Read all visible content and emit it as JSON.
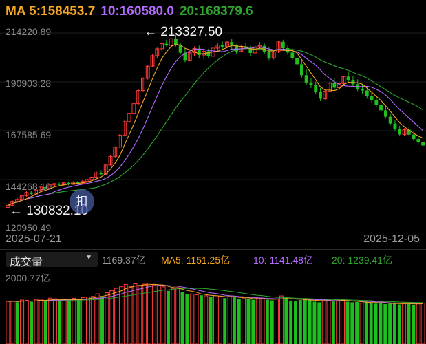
{
  "header": {
    "ma5": "MA 5:158453.7",
    "ma10": "10:160580.0",
    "ma20": "20:168379.6"
  },
  "colors": {
    "up": "#ff3b3b",
    "down": "#1fbf1f",
    "ma5": "#f5a623",
    "ma10": "#b36bff",
    "ma20": "#2fa52f",
    "bg": "#000000"
  },
  "y_ticks": [
    "214220.89",
    "190903.28",
    "167585.69",
    "144268.10",
    "120950.49"
  ],
  "dates": {
    "start": "2025-07-21",
    "end": "2025-12-05"
  },
  "annotations": {
    "high": "213327.50",
    "low": "130832.10"
  },
  "badge": {
    "text": "扣"
  },
  "volume_panel": {
    "selector_label": "成交量",
    "caret_icon": "caret-down-icon",
    "current": "1169.37亿",
    "ma5": "MA5: 1151.25亿",
    "ma10": "10: 1141.48亿",
    "ma20": "20: 1239.41亿",
    "max_label": "2000.77亿"
  },
  "chart_data": {
    "type": "candlestick",
    "price_range": [
      120950.49,
      214220.89
    ],
    "volume_max": 2000.77,
    "grid": true,
    "candles": [
      [
        131000,
        132200,
        130832.1,
        132000
      ],
      [
        132000,
        134300,
        131400,
        133900
      ],
      [
        133900,
        135600,
        133200,
        134800
      ],
      [
        134800,
        137000,
        134100,
        136600
      ],
      [
        136600,
        138800,
        136000,
        138100
      ],
      [
        138100,
        139000,
        136900,
        137400
      ],
      [
        137400,
        139800,
        137000,
        139300
      ],
      [
        139300,
        141200,
        138900,
        140700
      ],
      [
        140700,
        141300,
        139500,
        140100
      ],
      [
        140100,
        142100,
        139800,
        141700
      ],
      [
        141700,
        142600,
        140800,
        142300
      ],
      [
        142300,
        142800,
        141200,
        141800
      ],
      [
        141800,
        143100,
        141400,
        142700
      ],
      [
        142700,
        143300,
        141500,
        142000
      ],
      [
        142000,
        143500,
        141700,
        143000
      ],
      [
        143000,
        143600,
        141900,
        142400
      ],
      [
        142400,
        144000,
        142000,
        143500
      ],
      [
        143500,
        144700,
        143200,
        144300
      ],
      [
        144300,
        145800,
        143900,
        145400
      ],
      [
        145400,
        148000,
        145000,
        147500
      ],
      [
        147500,
        148700,
        146200,
        146800
      ],
      [
        146800,
        151600,
        146300,
        151200
      ],
      [
        151200,
        155800,
        150900,
        155300
      ],
      [
        155300,
        160200,
        154800,
        159800
      ],
      [
        159800,
        166000,
        159300,
        165500
      ],
      [
        165500,
        172400,
        165000,
        171900
      ],
      [
        171900,
        176300,
        170800,
        175900
      ],
      [
        175900,
        181000,
        175400,
        180500
      ],
      [
        180500,
        187300,
        180000,
        186800
      ],
      [
        186800,
        193100,
        186000,
        192600
      ],
      [
        192600,
        199000,
        192000,
        198400
      ],
      [
        198400,
        204100,
        197800,
        203400
      ],
      [
        203400,
        207300,
        202400,
        206700
      ],
      [
        206700,
        209700,
        205600,
        209100
      ],
      [
        209100,
        211000,
        207800,
        208300
      ],
      [
        208300,
        212000,
        207600,
        211500
      ],
      [
        211500,
        213327.5,
        207800,
        208600
      ],
      [
        208600,
        209700,
        203900,
        204800
      ],
      [
        204800,
        207000,
        200300,
        201300
      ],
      [
        201300,
        205500,
        200700,
        204800
      ],
      [
        204800,
        207800,
        203200,
        206800
      ],
      [
        206800,
        208200,
        202400,
        203700
      ],
      [
        203700,
        206300,
        201900,
        205500
      ],
      [
        205500,
        206700,
        202400,
        203100
      ],
      [
        203100,
        207600,
        202700,
        207000
      ],
      [
        207000,
        209300,
        205400,
        208500
      ],
      [
        208500,
        210200,
        206400,
        207700
      ],
      [
        207700,
        210600,
        207200,
        209900
      ],
      [
        209900,
        211400,
        206700,
        208300
      ],
      [
        208300,
        208800,
        204500,
        205400
      ],
      [
        205400,
        208600,
        204900,
        207800
      ],
      [
        207800,
        209700,
        206000,
        206900
      ],
      [
        206900,
        208100,
        203300,
        204700
      ],
      [
        204700,
        208400,
        204200,
        207600
      ],
      [
        207600,
        210000,
        206200,
        208100
      ],
      [
        208100,
        209200,
        204100,
        205300
      ],
      [
        205300,
        207700,
        201300,
        202300
      ],
      [
        202300,
        206000,
        201600,
        205200
      ],
      [
        205200,
        210600,
        204700,
        210000
      ],
      [
        210000,
        211000,
        205900,
        207000
      ],
      [
        207000,
        208200,
        203800,
        204900
      ],
      [
        204900,
        206800,
        201400,
        202400
      ],
      [
        202400,
        204400,
        198100,
        199300
      ],
      [
        199300,
        201200,
        193000,
        194100
      ],
      [
        194100,
        196800,
        189500,
        190600
      ],
      [
        190600,
        192700,
        188000,
        189300
      ],
      [
        189300,
        190900,
        185200,
        186000
      ],
      [
        186000,
        188000,
        181800,
        182900
      ],
      [
        182900,
        187100,
        182400,
        186400
      ],
      [
        186400,
        191000,
        185900,
        190300
      ],
      [
        190300,
        192600,
        187100,
        188100
      ],
      [
        188100,
        190800,
        187600,
        190100
      ],
      [
        190100,
        193900,
        189600,
        193400
      ],
      [
        193400,
        195800,
        190800,
        191700
      ],
      [
        191700,
        193600,
        188900,
        189800
      ],
      [
        189800,
        192100,
        186500,
        187400
      ],
      [
        187400,
        189700,
        185400,
        186800
      ],
      [
        186800,
        188600,
        182900,
        184000
      ],
      [
        184000,
        186400,
        181000,
        182100
      ],
      [
        182100,
        184100,
        178900,
        179800
      ],
      [
        179800,
        181600,
        176400,
        177300
      ],
      [
        177300,
        179400,
        173400,
        174300
      ],
      [
        174300,
        175900,
        170100,
        171000
      ],
      [
        171000,
        172800,
        167200,
        168400
      ],
      [
        168400,
        169900,
        164900,
        165800
      ],
      [
        165800,
        168800,
        165100,
        168100
      ],
      [
        168100,
        169500,
        164900,
        165700
      ],
      [
        165700,
        167200,
        162700,
        163600
      ],
      [
        163600,
        165300,
        161200,
        162300
      ],
      [
        162300,
        163900,
        159600,
        160500
      ]
    ],
    "volumes": [
      [
        1215,
        1
      ],
      [
        1228,
        1
      ],
      [
        1191,
        -1
      ],
      [
        1256,
        1
      ],
      [
        1247,
        1
      ],
      [
        1201,
        -1
      ],
      [
        1272,
        1
      ],
      [
        1284,
        1
      ],
      [
        1219,
        -1
      ],
      [
        1310,
        1
      ],
      [
        1292,
        1
      ],
      [
        1235,
        -1
      ],
      [
        1283,
        1
      ],
      [
        1237,
        -1
      ],
      [
        1305,
        1
      ],
      [
        1244,
        -1
      ],
      [
        1326,
        1
      ],
      [
        1344,
        1
      ],
      [
        1358,
        1
      ],
      [
        1431,
        1
      ],
      [
        1352,
        -1
      ],
      [
        1463,
        1
      ],
      [
        1521,
        1
      ],
      [
        1587,
        1
      ],
      [
        1634,
        1
      ],
      [
        1698,
        1
      ],
      [
        1642,
        1
      ],
      [
        1716,
        1
      ],
      [
        1668,
        1
      ],
      [
        1705,
        1
      ],
      [
        1732,
        1
      ],
      [
        1684,
        1
      ],
      [
        1660,
        1
      ],
      [
        1632,
        1
      ],
      [
        1515,
        -1
      ],
      [
        1574,
        1
      ],
      [
        1611,
        1
      ],
      [
        1488,
        -1
      ],
      [
        1433,
        -1
      ],
      [
        1427,
        1
      ],
      [
        1402,
        1
      ],
      [
        1389,
        -1
      ],
      [
        1374,
        1
      ],
      [
        1340,
        -1
      ],
      [
        1378,
        1
      ],
      [
        1366,
        1
      ],
      [
        1312,
        -1
      ],
      [
        1357,
        1
      ],
      [
        1334,
        -1
      ],
      [
        1291,
        -1
      ],
      [
        1315,
        1
      ],
      [
        1283,
        -1
      ],
      [
        1262,
        -1
      ],
      [
        1310,
        1
      ],
      [
        1298,
        1
      ],
      [
        1264,
        -1
      ],
      [
        1246,
        -1
      ],
      [
        1287,
        1
      ],
      [
        1372,
        1
      ],
      [
        1316,
        -1
      ],
      [
        1240,
        -1
      ],
      [
        1222,
        -1
      ],
      [
        1255,
        -1
      ],
      [
        1291,
        -1
      ],
      [
        1263,
        -1
      ],
      [
        1206,
        -1
      ],
      [
        1188,
        -1
      ],
      [
        1235,
        1
      ],
      [
        1274,
        1
      ],
      [
        1212,
        -1
      ],
      [
        1243,
        1
      ],
      [
        1268,
        1
      ],
      [
        1206,
        -1
      ],
      [
        1188,
        -1
      ],
      [
        1196,
        -1
      ],
      [
        1163,
        1
      ],
      [
        1207,
        -1
      ],
      [
        1173,
        -1
      ],
      [
        1152,
        -1
      ],
      [
        1181,
        -1
      ],
      [
        1138,
        -1
      ],
      [
        1146,
        -1
      ],
      [
        1160,
        -1
      ],
      [
        1128,
        -1
      ],
      [
        1174,
        1
      ],
      [
        1141,
        -1
      ],
      [
        1119,
        -1
      ],
      [
        1155,
        1
      ],
      [
        1169.37,
        1
      ]
    ]
  }
}
